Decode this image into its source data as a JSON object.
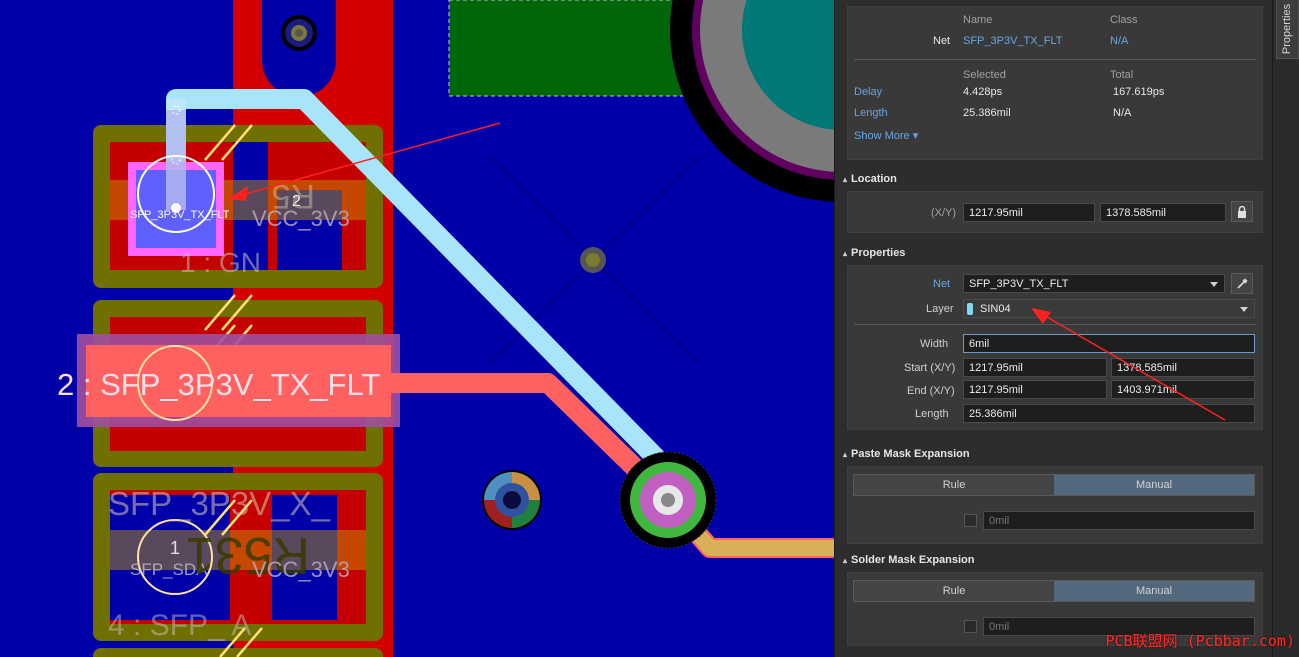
{
  "pcb": {
    "pad_net_label": "SFP_3P3V_TX_FLT",
    "pad_number": "2",
    "net_top_a": "VCC_3V3",
    "designator_a": "R5",
    "pin1_label": "1 : GN",
    "big_net_label": "2 : SFP_3P3V_TX_FLT",
    "lower_net_label": "SFP_3P3V_X_",
    "lower_pad_net": "SFP_SDA",
    "lower_pad_number": "1",
    "designator_b": "R531",
    "net_lower_b": "VCC_3V3",
    "pin4_label": "4 : SFP_   A"
  },
  "panel": {
    "header": {
      "col_name": "Name",
      "col_class": "Class",
      "net_label": "Net",
      "net_name": "SFP_3P3V_TX_FLT",
      "net_class": "N/A",
      "col_selected": "Selected",
      "col_total": "Total",
      "delay_label": "Delay",
      "delay_selected": "4.428ps",
      "delay_total": "167.619ps",
      "length_label": "Length",
      "length_selected": "25.386mil",
      "length_total": "N/A",
      "show_more": "Show More ▾"
    },
    "location": {
      "title": "Location",
      "xy_label": "(X/Y)",
      "x": "1217.95mil",
      "y": "1378.585mil"
    },
    "properties": {
      "title": "Properties",
      "net_label": "Net",
      "net_value": "SFP_3P3V_TX_FLT",
      "layer_label": "Layer",
      "layer_value": "SIN04",
      "layer_color": "#7fd7f2",
      "width_label": "Width",
      "width_value": "6mil",
      "start_label": "Start (X/Y)",
      "start_x": "1217.95mil",
      "start_y": "1378.585mil",
      "end_label": "End (X/Y)",
      "end_x": "1217.95mil",
      "end_y": "1403.971mil",
      "length_label": "Length",
      "length_value": "25.386mil"
    },
    "paste": {
      "title": "Paste Mask Expansion",
      "rule": "Rule",
      "manual": "Manual",
      "value": "0mil"
    },
    "solder": {
      "title": "Solder Mask Expansion",
      "rule": "Rule",
      "manual": "Manual",
      "value": "0mil"
    }
  },
  "sidetab": {
    "label": "Properties"
  },
  "watermark": "PCB联盟网 (Pcbbar.com)"
}
